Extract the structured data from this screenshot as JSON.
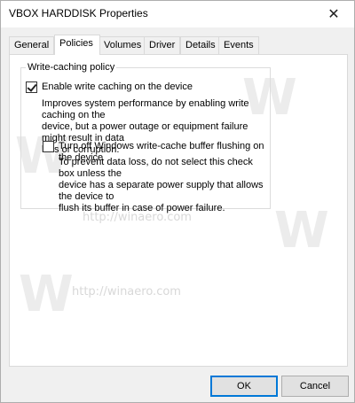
{
  "window": {
    "title": "VBOX HARDDISK Properties",
    "close_glyph": "✕"
  },
  "tabs": [
    {
      "label": "General",
      "active": false
    },
    {
      "label": "Policies",
      "active": true
    },
    {
      "label": "Volumes",
      "active": false
    },
    {
      "label": "Driver",
      "active": false
    },
    {
      "label": "Details",
      "active": false
    },
    {
      "label": "Events",
      "active": false
    }
  ],
  "policies": {
    "group_title": "Write-caching policy",
    "enable_write_caching": {
      "label": "Enable write caching on the device",
      "checked": true,
      "description_lines": [
        "Improves system performance by enabling write caching on the",
        "device, but a power outage or equipment failure might result in data",
        "loss or corruption."
      ]
    },
    "turn_off_flushing": {
      "label": "Turn off Windows write-cache buffer flushing on the device",
      "checked": false,
      "description_lines": [
        "To prevent data loss, do not select this check box unless the",
        "device has a separate power supply that allows the device to",
        "flush its buffer in case of power failure."
      ]
    }
  },
  "watermark": {
    "letter": "W",
    "url": "http://winaero.com"
  },
  "buttons": {
    "ok": "OK",
    "cancel": "Cancel"
  }
}
